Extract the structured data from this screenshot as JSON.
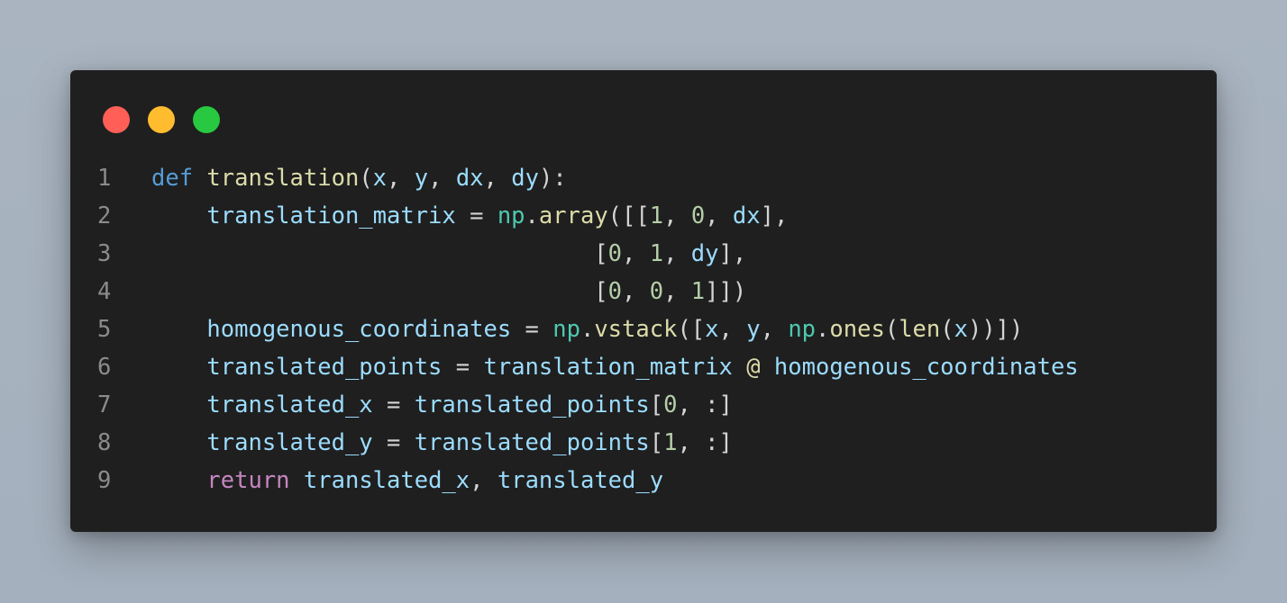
{
  "window": {
    "controls": [
      {
        "name": "close",
        "color": "#ff5f57"
      },
      {
        "name": "minimize",
        "color": "#febc2e"
      },
      {
        "name": "maximize",
        "color": "#28c840"
      }
    ]
  },
  "colors": {
    "background": "#1f1f1f",
    "line_number": "#8b8b8b",
    "keyword": "#569cd6",
    "function": "#dcdcaa",
    "variable": "#9cdcfe",
    "number": "#b5cea8",
    "module": "#4ec9b0",
    "control": "#c586c0",
    "punctuation": "#d4d4d4"
  },
  "code": {
    "lines": [
      {
        "number": "1",
        "tokens": [
          {
            "text": "def",
            "type": "keyword"
          },
          {
            "text": " ",
            "type": "punct"
          },
          {
            "text": "translation",
            "type": "function"
          },
          {
            "text": "(",
            "type": "punct"
          },
          {
            "text": "x",
            "type": "variable"
          },
          {
            "text": ", ",
            "type": "punct"
          },
          {
            "text": "y",
            "type": "variable"
          },
          {
            "text": ", ",
            "type": "punct"
          },
          {
            "text": "dx",
            "type": "variable"
          },
          {
            "text": ", ",
            "type": "punct"
          },
          {
            "text": "dy",
            "type": "variable"
          },
          {
            "text": "):",
            "type": "punct"
          }
        ]
      },
      {
        "number": "2",
        "tokens": [
          {
            "text": "    ",
            "type": "punct"
          },
          {
            "text": "translation_matrix",
            "type": "variable"
          },
          {
            "text": " = ",
            "type": "punct"
          },
          {
            "text": "np",
            "type": "module"
          },
          {
            "text": ".",
            "type": "punct"
          },
          {
            "text": "array",
            "type": "function"
          },
          {
            "text": "([[",
            "type": "punct"
          },
          {
            "text": "1",
            "type": "number"
          },
          {
            "text": ", ",
            "type": "punct"
          },
          {
            "text": "0",
            "type": "number"
          },
          {
            "text": ", ",
            "type": "punct"
          },
          {
            "text": "dx",
            "type": "variable"
          },
          {
            "text": "],",
            "type": "punct"
          }
        ]
      },
      {
        "number": "3",
        "tokens": [
          {
            "text": "                                [",
            "type": "punct"
          },
          {
            "text": "0",
            "type": "number"
          },
          {
            "text": ", ",
            "type": "punct"
          },
          {
            "text": "1",
            "type": "number"
          },
          {
            "text": ", ",
            "type": "punct"
          },
          {
            "text": "dy",
            "type": "variable"
          },
          {
            "text": "],",
            "type": "punct"
          }
        ]
      },
      {
        "number": "4",
        "tokens": [
          {
            "text": "                                [",
            "type": "punct"
          },
          {
            "text": "0",
            "type": "number"
          },
          {
            "text": ", ",
            "type": "punct"
          },
          {
            "text": "0",
            "type": "number"
          },
          {
            "text": ", ",
            "type": "punct"
          },
          {
            "text": "1",
            "type": "number"
          },
          {
            "text": "]])",
            "type": "punct"
          }
        ]
      },
      {
        "number": "5",
        "tokens": [
          {
            "text": "    ",
            "type": "punct"
          },
          {
            "text": "homogenous_coordinates",
            "type": "variable"
          },
          {
            "text": " = ",
            "type": "punct"
          },
          {
            "text": "np",
            "type": "module"
          },
          {
            "text": ".",
            "type": "punct"
          },
          {
            "text": "vstack",
            "type": "function"
          },
          {
            "text": "([",
            "type": "punct"
          },
          {
            "text": "x",
            "type": "variable"
          },
          {
            "text": ", ",
            "type": "punct"
          },
          {
            "text": "y",
            "type": "variable"
          },
          {
            "text": ", ",
            "type": "punct"
          },
          {
            "text": "np",
            "type": "module"
          },
          {
            "text": ".",
            "type": "punct"
          },
          {
            "text": "ones",
            "type": "function"
          },
          {
            "text": "(",
            "type": "punct"
          },
          {
            "text": "len",
            "type": "function"
          },
          {
            "text": "(",
            "type": "punct"
          },
          {
            "text": "x",
            "type": "variable"
          },
          {
            "text": "))])",
            "type": "punct"
          }
        ]
      },
      {
        "number": "6",
        "tokens": [
          {
            "text": "    ",
            "type": "punct"
          },
          {
            "text": "translated_points",
            "type": "variable"
          },
          {
            "text": " = ",
            "type": "punct"
          },
          {
            "text": "translation_matrix",
            "type": "variable"
          },
          {
            "text": " ",
            "type": "punct"
          },
          {
            "text": "@",
            "type": "function"
          },
          {
            "text": " ",
            "type": "punct"
          },
          {
            "text": "homogenous_coordinates",
            "type": "variable"
          }
        ]
      },
      {
        "number": "7",
        "tokens": [
          {
            "text": "    ",
            "type": "punct"
          },
          {
            "text": "translated_x",
            "type": "variable"
          },
          {
            "text": " = ",
            "type": "punct"
          },
          {
            "text": "translated_points",
            "type": "variable"
          },
          {
            "text": "[",
            "type": "punct"
          },
          {
            "text": "0",
            "type": "number"
          },
          {
            "text": ", :]",
            "type": "punct"
          }
        ]
      },
      {
        "number": "8",
        "tokens": [
          {
            "text": "    ",
            "type": "punct"
          },
          {
            "text": "translated_y",
            "type": "variable"
          },
          {
            "text": " = ",
            "type": "punct"
          },
          {
            "text": "translated_points",
            "type": "variable"
          },
          {
            "text": "[",
            "type": "punct"
          },
          {
            "text": "1",
            "type": "number"
          },
          {
            "text": ", :]",
            "type": "punct"
          }
        ]
      },
      {
        "number": "9",
        "tokens": [
          {
            "text": "    ",
            "type": "punct"
          },
          {
            "text": "return",
            "type": "control"
          },
          {
            "text": " ",
            "type": "punct"
          },
          {
            "text": "translated_x",
            "type": "variable"
          },
          {
            "text": ", ",
            "type": "punct"
          },
          {
            "text": "translated_y",
            "type": "variable"
          }
        ]
      }
    ]
  }
}
